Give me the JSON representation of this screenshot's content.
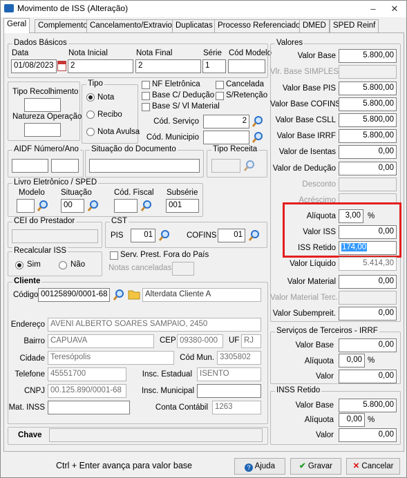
{
  "window": {
    "title": "Movimento de ISS (Alteração)",
    "minimize": "–",
    "close": "✕"
  },
  "tabs": [
    "Geral",
    "Complemento",
    "Cancelamento/Extravio",
    "Duplicatas",
    "Processo Referenciado",
    "DMED",
    "SPED Reinf"
  ],
  "dados_basicos": {
    "legend": "Dados Básicos",
    "data_label": "Data",
    "data_value": "01/08/2023",
    "nota_inicial_label": "Nota Inicial",
    "nota_inicial_value": "2",
    "nota_final_label": "Nota Final",
    "nota_final_value": "2",
    "serie_label": "Série",
    "serie_value": "1",
    "cod_modelo_label": "Cód Modelo",
    "cod_modelo_value": ""
  },
  "tipo_recolhimento": {
    "label": "Tipo Recolhimento",
    "value": ""
  },
  "natureza_operacao": {
    "label": "Natureza Operação",
    "value": ""
  },
  "tipo": {
    "legend": "Tipo",
    "options": [
      "Nota",
      "Recibo",
      "Nota Avulsa"
    ],
    "selected": "Nota"
  },
  "checks": {
    "nf_eletronica": "NF Eletrônica",
    "base_deducao": "Base C/ Dedução",
    "base_material": "Base S/ Vl Material",
    "cancelada": "Cancelada",
    "retencao": "S/Retenção"
  },
  "cod_servico": {
    "label": "Cód. Serviço",
    "value": "2"
  },
  "cod_municipio": {
    "label": "Cód. Municipio",
    "value": ""
  },
  "aidf": {
    "legend": "AIDF Número/Ano"
  },
  "situacao_documento": {
    "legend": "Situação do Documento"
  },
  "tipo_receita": {
    "legend": "Tipo Receita"
  },
  "livro": {
    "legend": "Livro Eletrônico / SPED",
    "modelo_label": "Modelo",
    "modelo_value": "",
    "situacao_label": "Situação",
    "situacao_value": "00",
    "cod_fiscal_label": "Cód. Fiscal",
    "cod_fiscal_value": "",
    "subserie_label": "Subsérie",
    "subserie_value": "001"
  },
  "cei": {
    "legend": "CEI do Prestador"
  },
  "cst": {
    "legend": "CST",
    "pis_label": "PIS",
    "pis_value": "01",
    "cofins_label": "COFINS",
    "cofins_value": "01"
  },
  "recalcular": {
    "legend": "Recalcular ISS",
    "sim": "Sim",
    "nao": "Não",
    "selected": "Sim"
  },
  "serv_prest": {
    "label": "Serv. Prest. Fora do País"
  },
  "notas_canceladas": {
    "label": "Notas canceladas",
    "value": ""
  },
  "cliente": {
    "legend": "Cliente",
    "codigo_label": "Código",
    "codigo_value": "00125890/0001-68",
    "nome_value": "Alterdata Cliente A",
    "endereco_label": "Endereço",
    "endereco_value": "AVENI ALBERTO SOARES SAMPAIO, 2450",
    "bairro_label": "Bairro",
    "bairro_value": "CAPUAVA",
    "cep_label": "CEP",
    "cep_value": "09380-000",
    "uf_label": "UF",
    "uf_value": "RJ",
    "cidade_label": "Cidade",
    "cidade_value": "Teresópolis",
    "cod_mun_label": "Cód Mun.",
    "cod_mun_value": "3305802",
    "telefone_label": "Telefone",
    "telefone_value": "45551700",
    "insc_estadual_label": "Insc. Estadual",
    "insc_estadual_value": "ISENTO",
    "cnpj_label": "CNPJ",
    "cnpj_value": "00.125.890/0001-68",
    "insc_municipal_label": "Insc. Municipal",
    "insc_municipal_value": "",
    "mat_inss_label": "Mat. INSS",
    "mat_inss_value": "",
    "conta_contabil_label": "Conta Contábil",
    "conta_contabil_value": "1263"
  },
  "chave": {
    "label": "Chave",
    "value": ""
  },
  "valores": {
    "legend": "Valores",
    "valor_base": {
      "label": "Valor Base",
      "value": "5.800,00"
    },
    "vlr_base_simples": {
      "label": "Vlr. Base SIMPLES",
      "value": ""
    },
    "valor_base_pis": {
      "label": "Valor Base PIS",
      "value": "5.800,00"
    },
    "valor_base_cofins": {
      "label": "Valor Base COFINS",
      "value": "5.800,00"
    },
    "valor_base_csll": {
      "label": "Valor Base CSLL",
      "value": "5.800,00"
    },
    "valor_base_irrf": {
      "label": "Valor Base IRRF",
      "value": "5.800,00"
    },
    "valor_isentas": {
      "label": "Valor de Isentas",
      "value": "0,00"
    },
    "valor_deducao": {
      "label": "Valor de Dedução",
      "value": "0,00"
    },
    "desconto": {
      "label": "Desconto",
      "value": ""
    },
    "acrescimo": {
      "label": "Acréscimo",
      "value": ""
    },
    "aliquota": {
      "label": "Alíquota",
      "value": "3,00",
      "unit": "%"
    },
    "valor_iss": {
      "label": "Valor ISS",
      "value": "0,00"
    },
    "iss_retido": {
      "label": "ISS Retido",
      "value": "174,00"
    },
    "valor_liquido": {
      "label": "Valor Líquido",
      "value": "5.414,30"
    },
    "valor_material": {
      "label": "Valor Material",
      "value": "0,00"
    },
    "valor_material_terc": {
      "label": "Valor Material Terc.",
      "value": ""
    },
    "valor_subempreit": {
      "label": "Valor Subempreit.",
      "value": "0,00"
    }
  },
  "servicos_terceiros": {
    "legend": "Serviços de Terceiros - IRRF",
    "valor_base": {
      "label": "Valor Base",
      "value": "0,00"
    },
    "aliquota": {
      "label": "Alíquota",
      "value": "0,00",
      "unit": "%"
    },
    "valor": {
      "label": "Valor",
      "value": "0,00"
    }
  },
  "inss_retido": {
    "legend": "INSS Retido",
    "valor_base": {
      "label": "Valor Base",
      "value": "5.800,00"
    },
    "aliquota": {
      "label": "Alíquota",
      "value": "0,00",
      "unit": "%"
    },
    "valor": {
      "label": "Valor",
      "value": "0,00"
    }
  },
  "footer": {
    "hint": "Ctrl + Enter avança para valor base",
    "ajuda": "Ajuda",
    "gravar": "Gravar",
    "cancelar": "Cancelar"
  },
  "colors": {
    "highlight_border": "#e31e1e",
    "selection": "#3399ff"
  }
}
